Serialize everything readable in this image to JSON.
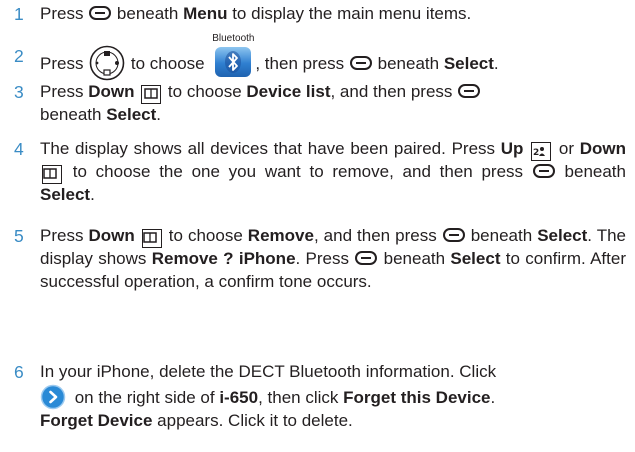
{
  "steps": [
    {
      "num": "1",
      "t1": "Press ",
      "b1": " beneath ",
      "bold1": "Menu",
      "t2": " to display the main menu items."
    },
    {
      "num": "2",
      "t1": "Press ",
      "t2": " to choose ",
      "icon_label": "Bluetooth",
      "t3": ", then press ",
      "t4": " beneath ",
      "bold1": "Select",
      "t5": "."
    },
    {
      "num": "3",
      "t1": "Press ",
      "bold1": "Down",
      "t2": " to choose ",
      "bold2": "Device list",
      "t3": ", and then press ",
      "t4": "beneath ",
      "bold3": "Select",
      "t5": "."
    },
    {
      "num": "4",
      "t1": "The display shows all devices that have been paired. Press ",
      "bold1": "Up",
      "t2": " or ",
      "bold2": "Down",
      "t3": " to choose the one you want to remove, and then press ",
      "t4": " beneath ",
      "bold3": "Select",
      "t5": "."
    },
    {
      "num": "5",
      "t1": "Press ",
      "bold1": "Down",
      "t2": " to choose ",
      "bold2": "Remove",
      "t3": ", and then press ",
      "t4": " beneath ",
      "bold3": "Select",
      "t5": ". The display shows ",
      "bold4": "Remove ? iPhone",
      "t6": ". Press ",
      "t7": " beneath ",
      "bold5": "Select",
      "t8": " to confirm. After successful operation, a confirm tone occurs."
    },
    {
      "num": "6",
      "t1": "In your iPhone, delete the DECT Bluetooth information. Click ",
      "t2": " on the right side of ",
      "bold1": "i-650",
      "t3": ", then click ",
      "bold2": "Forget this Device",
      "t4": ". ",
      "bold3": "Forget Device",
      "t5": " appears. Click it to delete."
    }
  ],
  "colors": {
    "accent": "#3a8cc5",
    "text": "#231f20"
  },
  "icons": [
    "softkey-icon",
    "navigation-pad-icon",
    "bluetooth-icon",
    "down-key-icon",
    "up-key-icon",
    "info-arrow-icon"
  ]
}
